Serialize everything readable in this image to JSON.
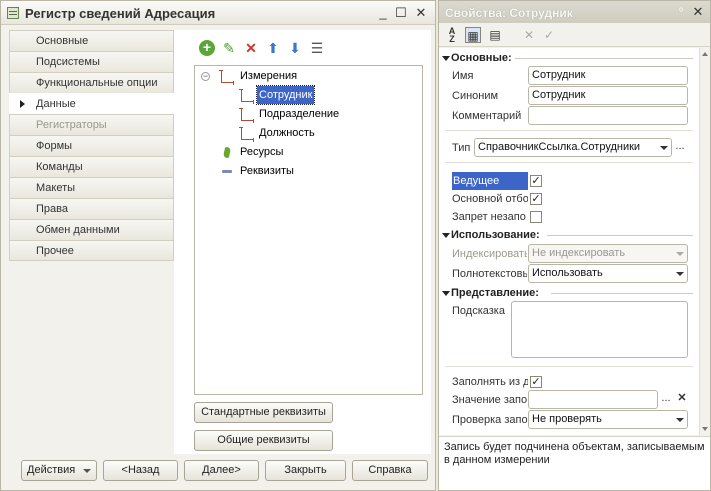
{
  "left_window": {
    "title": "Регистр сведений Адресация",
    "controls": {
      "minimize": "_",
      "maximize": "☐",
      "close": "✕"
    },
    "nav_items": [
      {
        "label": "Основные",
        "state": "normal"
      },
      {
        "label": "Подсистемы",
        "state": "normal"
      },
      {
        "label": "Функциональные опции",
        "state": "normal"
      },
      {
        "label": "Данные",
        "state": "active"
      },
      {
        "label": "Регистраторы",
        "state": "disabled"
      },
      {
        "label": "Формы",
        "state": "normal"
      },
      {
        "label": "Команды",
        "state": "normal"
      },
      {
        "label": "Макеты",
        "state": "normal"
      },
      {
        "label": "Права",
        "state": "normal"
      },
      {
        "label": "Обмен данными",
        "state": "normal"
      },
      {
        "label": "Прочее",
        "state": "normal"
      }
    ],
    "toolbar_icons": [
      "add-icon",
      "edit-icon",
      "delete-icon",
      "move-up-icon",
      "move-down-icon",
      "list-icon"
    ],
    "tree": {
      "dimensions": "Измерения",
      "children": [
        "Сотрудник",
        "Подразделение",
        "Должность"
      ],
      "resources": "Ресурсы",
      "attributes": "Реквизиты"
    },
    "standard_attrs_button": "Стандартные реквизиты",
    "common_attrs_button": "Общие реквизиты",
    "footer": {
      "actions": "Действия",
      "back": "<Назад",
      "next": "Далее>",
      "close": "Закрыть",
      "help": "Справка"
    }
  },
  "right_window": {
    "title": "Свойства: Сотрудник",
    "controls": {
      "pin": "ᵒ",
      "close": "✕"
    },
    "sections": {
      "main": "Основные:",
      "usage": "Использование:",
      "presentation": "Представление:"
    },
    "fields": {
      "name_label": "Имя",
      "name_value": "Сотрудник",
      "synonym_label": "Синоним",
      "synonym_value": "Сотрудник",
      "comment_label": "Комментарий",
      "comment_value": "",
      "type_label": "Тип",
      "type_value": "СправочникСсылка.Сотрудники",
      "master_label": "Ведущее",
      "master_checked": true,
      "main_filter_label": "Основной отбо",
      "main_filter_checked": true,
      "deny_empty_label": "Запрет незапо",
      "deny_empty_checked": false,
      "indexing_label": "Индексировать",
      "indexing_value": "Не индексировать",
      "fulltext_label": "Полнотекстовы",
      "fulltext_value": "Использовать",
      "tooltip_label": "Подсказка",
      "tooltip_value": "",
      "fill_from_label": "Заполнять из д",
      "fill_from_checked": true,
      "fill_value_label": "Значение запо",
      "fill_value_value": "",
      "fill_check_label": "Проверка запо",
      "fill_check_value": "Не проверять"
    },
    "ellipsis": "...",
    "clear": "✕",
    "hint_text": "Запись будет подчинена объектам, записываемым в данном измерении"
  }
}
